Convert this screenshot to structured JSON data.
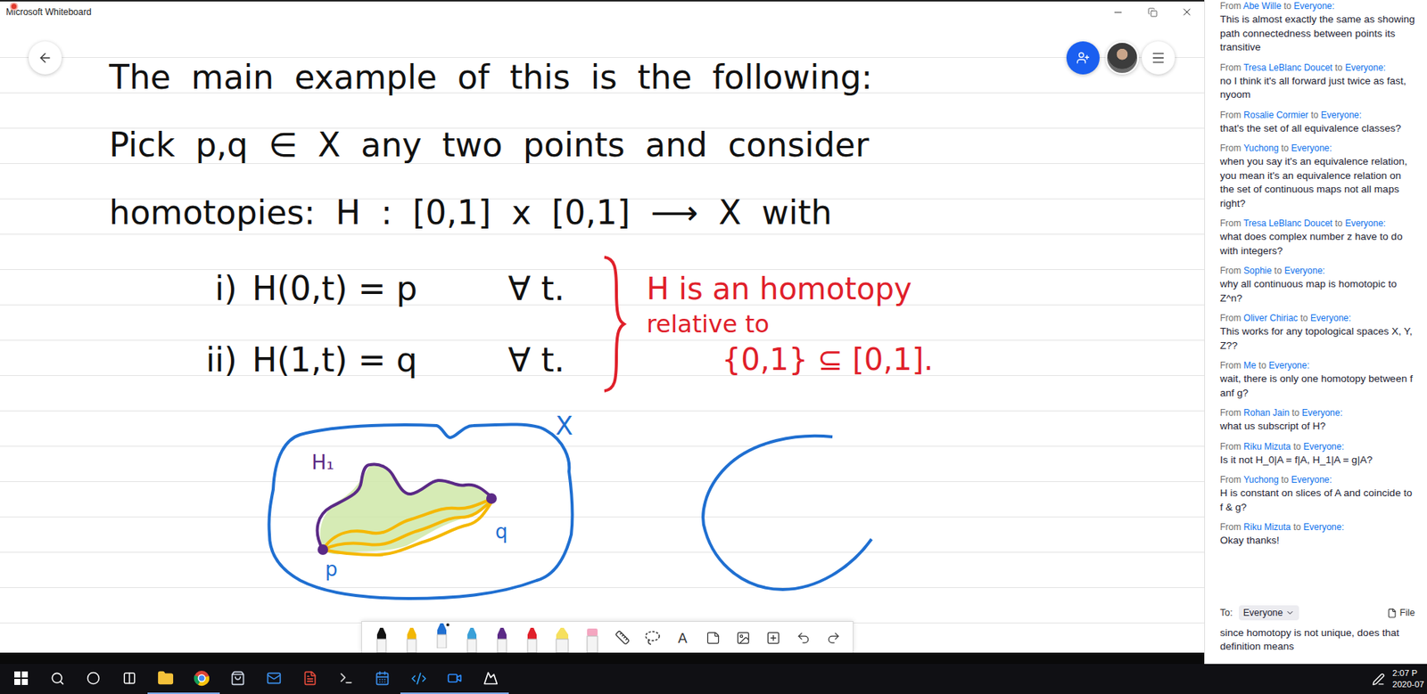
{
  "window": {
    "title": "Microsoft Whiteboard"
  },
  "board": {
    "lines": [
      "The main example of this is the following:",
      "Pick p,q ∈ X any two points and consider",
      "homotopies: H : [0,1] x [0,1] ⟶ X with"
    ],
    "conditions": [
      {
        "label": "i)",
        "formula": "H(0,t) = p",
        "quantifier": "∀ t."
      },
      {
        "label": "ii)",
        "formula": "H(1,t) = q",
        "quantifier": "∀ t."
      }
    ],
    "annotation": [
      "H is an homotopy",
      "relative to",
      "{0,1} ⊆ [0,1]."
    ],
    "figure": {
      "space": "X",
      "path": "H₁",
      "start": "p",
      "end": "q"
    }
  },
  "toolbar": [
    {
      "kind": "pen",
      "color": "#111111",
      "selected": false
    },
    {
      "kind": "pen",
      "color": "#f2b705",
      "selected": false
    },
    {
      "kind": "pen",
      "color": "#1f6fd1",
      "selected": true
    },
    {
      "kind": "pen",
      "color": "#3aa0d8",
      "selected": false
    },
    {
      "kind": "pen",
      "color": "#5b2a86",
      "selected": false
    },
    {
      "kind": "pen",
      "color": "#e0202a",
      "selected": false
    },
    {
      "kind": "highlighter",
      "color": "#f6e05e",
      "selected": false
    },
    {
      "kind": "eraser",
      "color": "#f4a6c0",
      "selected": false
    },
    {
      "kind": "ruler",
      "selected": false
    },
    {
      "kind": "lasso",
      "selected": false
    },
    {
      "kind": "text",
      "label": "A",
      "selected": false
    },
    {
      "kind": "note",
      "selected": false
    },
    {
      "kind": "image",
      "selected": false
    },
    {
      "kind": "insert",
      "selected": false
    },
    {
      "kind": "undo",
      "selected": false
    },
    {
      "kind": "redo",
      "selected": false
    }
  ],
  "chat": {
    "from_word": "From",
    "to_word": "to",
    "messages": [
      {
        "sender": "Abe Wille",
        "recipient": "Everyone:",
        "text": "This is almost exactly the same as showing path connectedness between points its transitive"
      },
      {
        "sender": "Tresa LeBlanc Doucet",
        "recipient": "Everyone:",
        "text": "no I think it's all forward just twice as fast, nyoom"
      },
      {
        "sender": "Rosalie Cormier",
        "recipient": "Everyone:",
        "text": "that's the set of all equivalence classes?"
      },
      {
        "sender": "Yuchong",
        "recipient": "Everyone:",
        "text": "when you say it's an equivalence relation, you mean it's an equivalence relation on the set of continuous maps not all maps right?"
      },
      {
        "sender": "Tresa LeBlanc Doucet",
        "recipient": "Everyone:",
        "text": "what does complex number z have to do with integers?"
      },
      {
        "sender": "Sophie",
        "recipient": "Everyone:",
        "text": "why all continuous map is homotopic to Z^n?"
      },
      {
        "sender": "Oliver Chiriac",
        "recipient": "Everyone:",
        "text": "This works for any topological spaces X, Y, Z??"
      },
      {
        "sender": "Me",
        "recipient": "Everyone:",
        "text": "wait, there is only one homotopy between f anf g?"
      },
      {
        "sender": "Rohan Jain",
        "recipient": "Everyone:",
        "text": "what us subscript of H?"
      },
      {
        "sender": "Riku Mizuta",
        "recipient": "Everyone:",
        "text": "Is it not H_0|A = f|A, H_1|A = g|A?"
      },
      {
        "sender": "Yuchong",
        "recipient": "Everyone:",
        "text": "H is constant on slices of A and coincide to f & g?"
      },
      {
        "sender": "Riku Mizuta",
        "recipient": "Everyone:",
        "text": "Okay thanks!"
      }
    ],
    "compose": {
      "to_label": "To:",
      "recipient": "Everyone",
      "file": "File",
      "draft": "since homotopy is not unique, does that definition means"
    }
  },
  "taskbar": {
    "time": "2:07 P",
    "date": "2020-07"
  }
}
